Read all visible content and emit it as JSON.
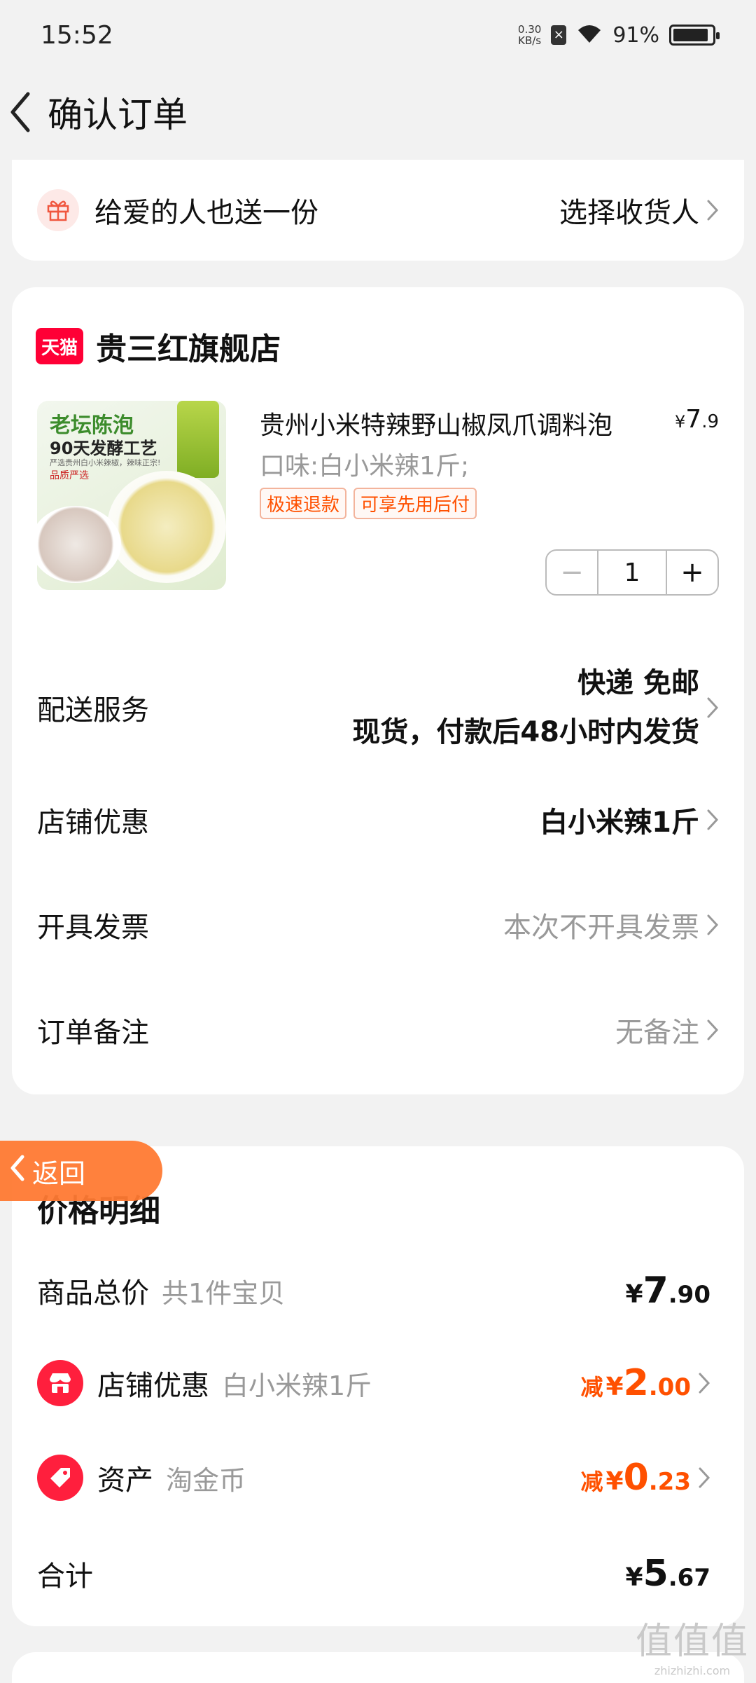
{
  "status": {
    "time": "15:52",
    "net_speed_top": "0.30",
    "net_speed_bottom": "KB/s",
    "battery_pct": "91%",
    "battery_level": 0.91
  },
  "nav": {
    "title": "确认订单"
  },
  "gift": {
    "label": "给爱的人也送一份",
    "action": "选择收货人"
  },
  "shop": {
    "logo_text": "天猫",
    "name": "贵三红旗舰店",
    "product": {
      "image_text": {
        "line1": "老坛陈泡",
        "line2": "90天发酵工艺",
        "line3": "严选贵州白小米辣椒，辣味正宗!",
        "line4": "品质严选"
      },
      "title": "贵州小米特辣野山椒凤爪调料泡",
      "price_symbol": "¥",
      "price_int": "7",
      "price_dec": ".9",
      "spec": "口味:白小米辣1斤;",
      "tags": [
        "极速退款",
        "可享先用后付"
      ],
      "quantity": "1",
      "minus": "−",
      "plus": "+"
    },
    "rows": {
      "delivery": {
        "label": "配送服务",
        "line1": "快递 免邮",
        "line2": "现货，付款后48小时内发货"
      },
      "discount": {
        "label": "店铺优惠",
        "value": "白小米辣1斤"
      },
      "invoice": {
        "label": "开具发票",
        "value": "本次不开具发票"
      },
      "note": {
        "label": "订单备注",
        "value": "无备注"
      }
    }
  },
  "back_float": {
    "label": "返回"
  },
  "price_detail": {
    "title": "价格明细",
    "total_goods": {
      "label": "商品总价",
      "sub": "共1件宝贝",
      "yen": "¥",
      "int": "7",
      "dec": ".90"
    },
    "shop_discount": {
      "label": "店铺优惠",
      "sub": "白小米辣1斤",
      "prefix": "减",
      "yen": "¥",
      "int": "2",
      "dec": ".00"
    },
    "assets": {
      "label": "资产",
      "sub": "淘金币",
      "prefix": "减",
      "yen": "¥",
      "int": "0",
      "dec": ".23"
    },
    "total": {
      "label": "合计",
      "yen": "¥",
      "int": "5",
      "dec": ".67"
    }
  },
  "watermark": {
    "main": "值值值",
    "sub": "zhizhizhi.com"
  },
  "colors": {
    "accent": "#ff5000",
    "tmall_red": "#ff0036",
    "back_float": "#ff7a33",
    "icon_red": "#ff1f3d"
  }
}
